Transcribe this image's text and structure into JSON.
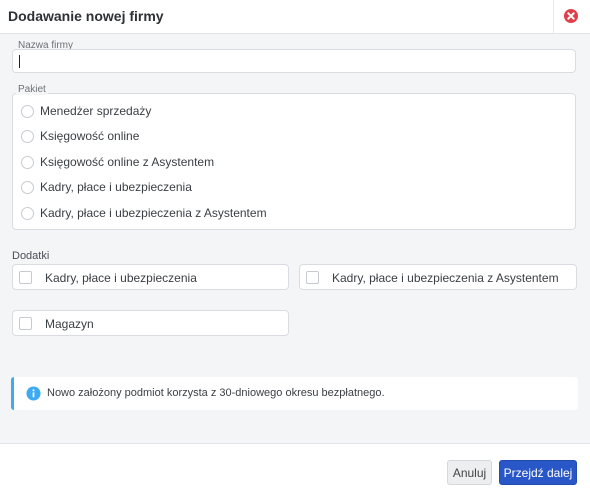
{
  "dialog": {
    "title": "Dodawanie nowej firmy"
  },
  "company_name": {
    "label": "Nazwa firmy",
    "value": ""
  },
  "package": {
    "label": "Pakiet",
    "options": [
      {
        "label": "Menedżer sprzedaży",
        "selected": false
      },
      {
        "label": "Księgowość online",
        "selected": false
      },
      {
        "label": "Księgowość online z Asystentem",
        "selected": false
      },
      {
        "label": "Kadry, płace i ubezpieczenia",
        "selected": false
      },
      {
        "label": "Kadry, płace i ubezpieczenia z Asystentem",
        "selected": false
      }
    ]
  },
  "addons": {
    "label": "Dodatki",
    "items": [
      {
        "label": "Kadry, płace i ubezpieczenia",
        "checked": false
      },
      {
        "label": "Kadry, płace i ubezpieczenia z Asystentem",
        "checked": false
      },
      {
        "label": "Magazyn",
        "checked": false
      }
    ]
  },
  "info": {
    "text": "Nowo założony podmiot korzysta z 30-dniowego okresu bezpłatnego.",
    "accent_color": "#3eaaf2",
    "icon": "info-icon"
  },
  "footer": {
    "cancel_label": "Anuluj",
    "next_label": "Przejdź dalej",
    "next_color": "#2a57c7"
  },
  "close": {
    "icon": "close-icon",
    "color": "#e0404a"
  }
}
